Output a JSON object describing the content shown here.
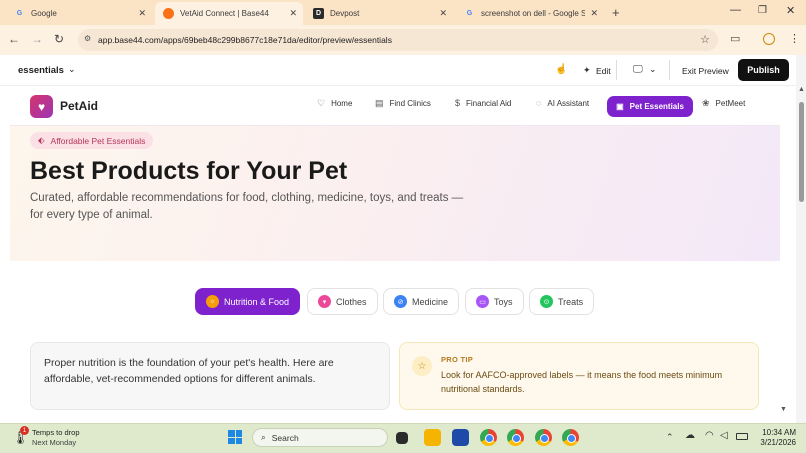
{
  "browser": {
    "tabs": [
      {
        "title": "Google",
        "icon": "google-icon"
      },
      {
        "title": "VetAid Connect | Base44",
        "icon": "base44-icon",
        "active": true
      },
      {
        "title": "Devpost",
        "icon": "devpost-icon"
      },
      {
        "title": "screenshot on dell - Google Se",
        "icon": "google-icon"
      }
    ],
    "url": "app.base44.com/apps/69beb48c299b8677c18e71da/editor/preview/essentials"
  },
  "editor": {
    "page_name": "essentials",
    "edit_label": "Edit",
    "exit_label": "Exit Preview",
    "publish_label": "Publish"
  },
  "site": {
    "brand": "PetAid",
    "nav": [
      {
        "label": "Home",
        "icon": "heart-icon"
      },
      {
        "label": "Find Clinics",
        "icon": "map-icon"
      },
      {
        "label": "Financial Aid",
        "icon": "dollar-icon"
      },
      {
        "label": "AI Assistant",
        "icon": "chat-icon"
      },
      {
        "label": "Pet Essentials",
        "icon": "bag-icon",
        "active": true
      },
      {
        "label": "PetMeet",
        "icon": "paw-icon"
      }
    ],
    "hero": {
      "badge": "Affordable Pet Essentials",
      "title": "Best Products for Your Pet",
      "subtitle": "Curated, affordable recommendations for food, clothing, medicine, toys, and treats — for every type of animal."
    },
    "categories": [
      {
        "label": "Nutrition & Food",
        "active": true,
        "color": "#f59e0b"
      },
      {
        "label": "Clothes",
        "color": "#ec4899"
      },
      {
        "label": "Medicine",
        "color": "#3b82f6"
      },
      {
        "label": "Toys",
        "color": "#a855f7"
      },
      {
        "label": "Treats",
        "color": "#22c55e"
      }
    ],
    "intro": "Proper nutrition is the foundation of your pet's health. Here are affordable, vet-recommended options for different animals.",
    "tip": {
      "label": "PRO TIP",
      "text": "Look for AAFCO-approved labels — it means the food meets minimum nutritional standards."
    }
  },
  "taskbar": {
    "weather_title": "Temps to drop",
    "weather_sub": "Next Monday",
    "weather_badge": "1",
    "search_placeholder": "Search",
    "time": "10:34 AM",
    "date": "3/21/2026"
  },
  "colors": {
    "accent": "#7e22ce",
    "brand_pink": "#d6336c"
  }
}
